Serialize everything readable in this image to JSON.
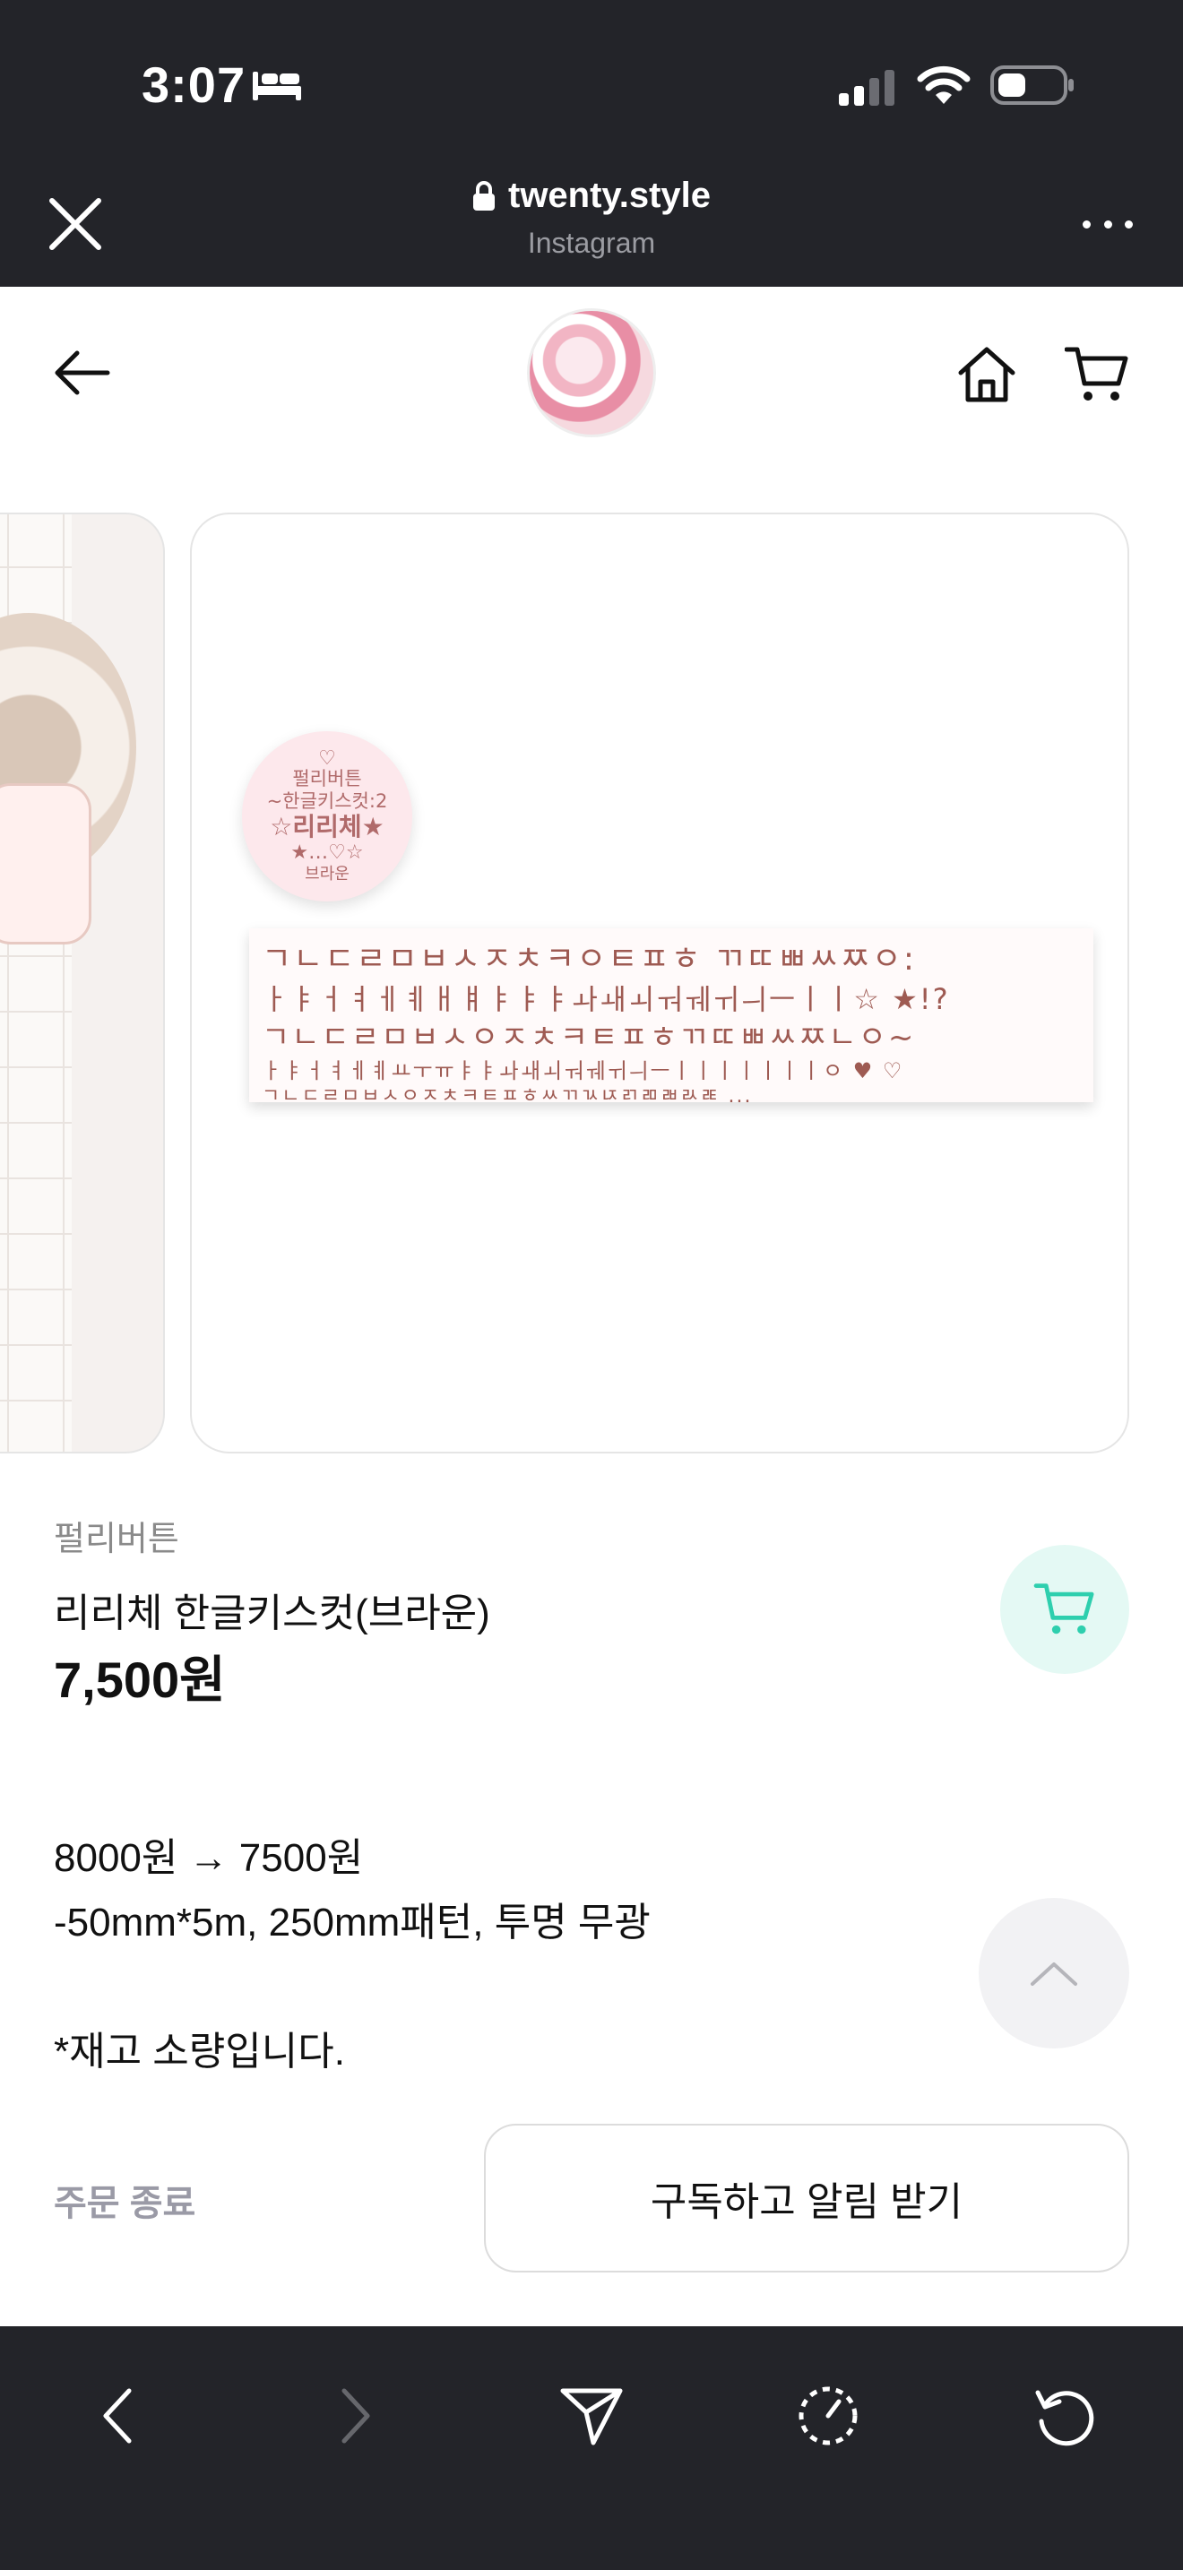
{
  "status_bar": {
    "time": "3:07",
    "icons": [
      "bed-icon",
      "signal-icon",
      "wifi-icon",
      "battery-icon"
    ]
  },
  "browser": {
    "url": "twenty.style",
    "source": "Instagram",
    "icons": [
      "close-icon",
      "lock-icon",
      "more-icon"
    ]
  },
  "store_header": {
    "icons": [
      "back-arrow-icon",
      "home-icon",
      "cart-icon"
    ]
  },
  "product_image": {
    "circle_lines": [
      "♡",
      "펄리버튼",
      "~한글키스컷:2",
      "☆리리체★",
      "★…♡☆",
      "브라운"
    ],
    "strip_rows": [
      "ㄱㄴㄷㄹㅁㅂㅅㅈㅊㅋㅇㅌㅍㅎ ㄲㄸㅃㅆㅉㅇ:",
      "ㅏㅑㅓㅕㅔㅖㅐㅒㅑㅑㅑㅘㅙㅚㅝㅞㅟㅢㅡㅣㅣ☆ ★!?",
      "ㄱㄴㄷㄹㅁㅂㅅㅇㅈㅊㅋㅌㅍㅎㄲㄸㅃㅆㅉㄴㅇ~",
      "ㅏㅑㅓㅕㅔㅖㅛㅜㅠㅑㅑㅘㅙㅚㅝㅞㅟㅢㅡㅣㅣㅣㅣㅣㅣㅣㅇ ♥ ♡",
      "ㄱㄴㄷㄹㅁㅂㅅㅇㅈㅊㅋㅌㅍㅎㅆㄲㄳㄵㄺㄻㄼㄽㄾ ..."
    ]
  },
  "product": {
    "brand": "펄리버튼",
    "name": "리리체 한글키스컷(브라운)",
    "price": "7,500원"
  },
  "description": {
    "line1": "8000원 → 7500원",
    "line2": "-50mm*5m, 250mm패턴, 투명 무광",
    "line3": "*재고 소량입니다."
  },
  "order": {
    "status": "주문 종료",
    "subscribe_label": "구독하고 알림 받기"
  },
  "colors": {
    "dark_bar": "#232429",
    "accent_teal": "#2ecfae",
    "accent_teal_bg": "#e4f9f4",
    "muted_text": "#9a9aa6"
  },
  "toolbar": {
    "icons": [
      "back-icon",
      "forward-icon",
      "share-icon",
      "timer-icon",
      "reload-icon"
    ]
  }
}
